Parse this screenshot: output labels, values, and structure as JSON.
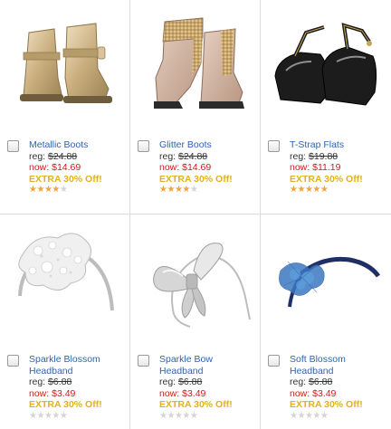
{
  "products": [
    {
      "name": "Metallic Boots",
      "reg_label": "reg:",
      "reg_price": "$24.88",
      "now_label": "now:",
      "now_price": "$14.69",
      "promo": "EXTRA 30% Off!",
      "rating": 3.5,
      "icon": "gold-ankle-boots-image"
    },
    {
      "name": "Glitter Boots",
      "reg_label": "reg:",
      "reg_price": "$24.88",
      "now_label": "now:",
      "now_price": "$14.69",
      "promo": "EXTRA 30% Off!",
      "rating": 3.5,
      "icon": "glitter-chelsea-boots-image"
    },
    {
      "name": "T-Strap Flats",
      "reg_label": "reg:",
      "reg_price": "$19.88",
      "now_label": "now:",
      "now_price": "$11.19",
      "promo": "EXTRA 30% Off!",
      "rating": 4.5,
      "icon": "black-patent-t-strap-flats-image"
    },
    {
      "name": "Sparkle Blossom Headband",
      "reg_label": "reg:",
      "reg_price": "$6.88",
      "now_label": "now:",
      "now_price": "$3.49",
      "promo": "EXTRA 30% Off!",
      "rating": 0,
      "icon": "silver-blossom-headband-image"
    },
    {
      "name": "Sparkle Bow Headband",
      "reg_label": "reg:",
      "reg_price": "$6.88",
      "now_label": "now:",
      "now_price": "$3.49",
      "promo": "EXTRA 30% Off!",
      "rating": 0,
      "icon": "silver-bow-headband-image"
    },
    {
      "name": "Soft Blossom Headband",
      "reg_label": "reg:",
      "reg_price": "$6.88",
      "now_label": "now:",
      "now_price": "$3.49",
      "promo": "EXTRA 30% Off!",
      "rating": 0,
      "icon": "blue-blossom-headband-image"
    }
  ],
  "colors": {
    "link": "#2b64b3",
    "sale": "#d11a1a",
    "promo": "#e2b21a",
    "star_on": "#f2a23a",
    "star_off": "#d4d4d4"
  }
}
